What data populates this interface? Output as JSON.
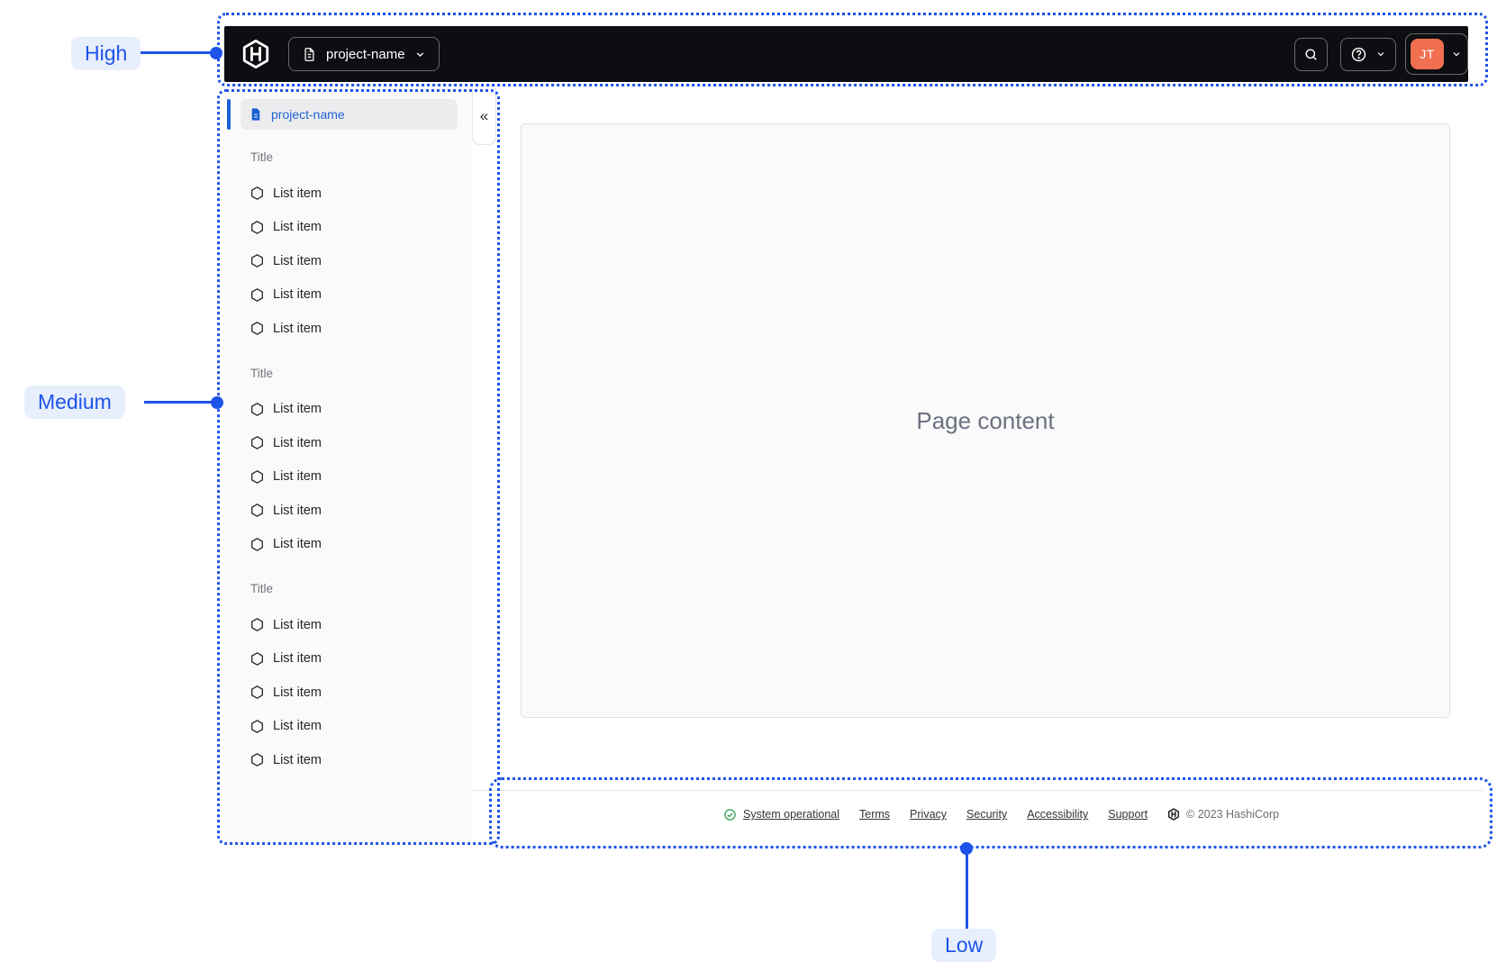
{
  "annotations": {
    "high": "High",
    "medium": "Medium",
    "low": "Low"
  },
  "navbar": {
    "project_switcher": {
      "label": "project-name"
    },
    "user": {
      "initials": "JT"
    }
  },
  "sidebar": {
    "active_item": {
      "label": "project-name"
    },
    "collapse_glyph": "«",
    "sections": [
      {
        "title": "Title",
        "items": [
          "List item",
          "List item",
          "List item",
          "List item",
          "List item"
        ]
      },
      {
        "title": "Title",
        "items": [
          "List item",
          "List item",
          "List item",
          "List item",
          "List item"
        ]
      },
      {
        "title": "Title",
        "items": [
          "List item",
          "List item",
          "List item",
          "List item",
          "List item"
        ]
      }
    ]
  },
  "content": {
    "placeholder": "Page content"
  },
  "footer": {
    "status": "System operational",
    "links": [
      "Terms",
      "Privacy",
      "Security",
      "Accessibility",
      "Support"
    ],
    "copyright": "© 2023 HashiCorp"
  },
  "icons": {
    "brand": "hashicorp-logo",
    "project": "file-text-icon",
    "search": "magnifier-icon",
    "help": "question-circle-icon",
    "dropdown": "chevron-down-icon",
    "collapse": "double-chevron-left-icon",
    "status": "check-circle-icon",
    "list_item": "hexagon-icon"
  },
  "colors": {
    "annotation_blue": "#1e53ea",
    "annotation_bg": "#e8effc",
    "active_blue": "#1c61d2",
    "avatar_orange": "#ef6f4f",
    "success_green": "#2e9e4d",
    "navbar_bg": "#0d0e12"
  }
}
